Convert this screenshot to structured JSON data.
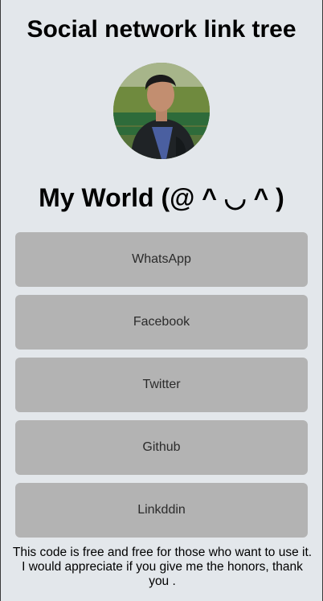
{
  "header": {
    "title": "Social network link tree"
  },
  "profile": {
    "avatar_icon": "profile-photo",
    "name": "My World (@ ^ ◡ ^ )"
  },
  "links": [
    {
      "label": "WhatsApp"
    },
    {
      "label": "Facebook"
    },
    {
      "label": "Twitter"
    },
    {
      "label": "Github"
    },
    {
      "label": "Linkddin"
    }
  ],
  "footer": {
    "note": "This code is free and free for those who want to use it. I would appreciate if you give me the honors, thank you ."
  },
  "colors": {
    "page_background": "#e3e7eb",
    "button_background": "#b3b3b3",
    "button_text": "#2b2b2b"
  }
}
